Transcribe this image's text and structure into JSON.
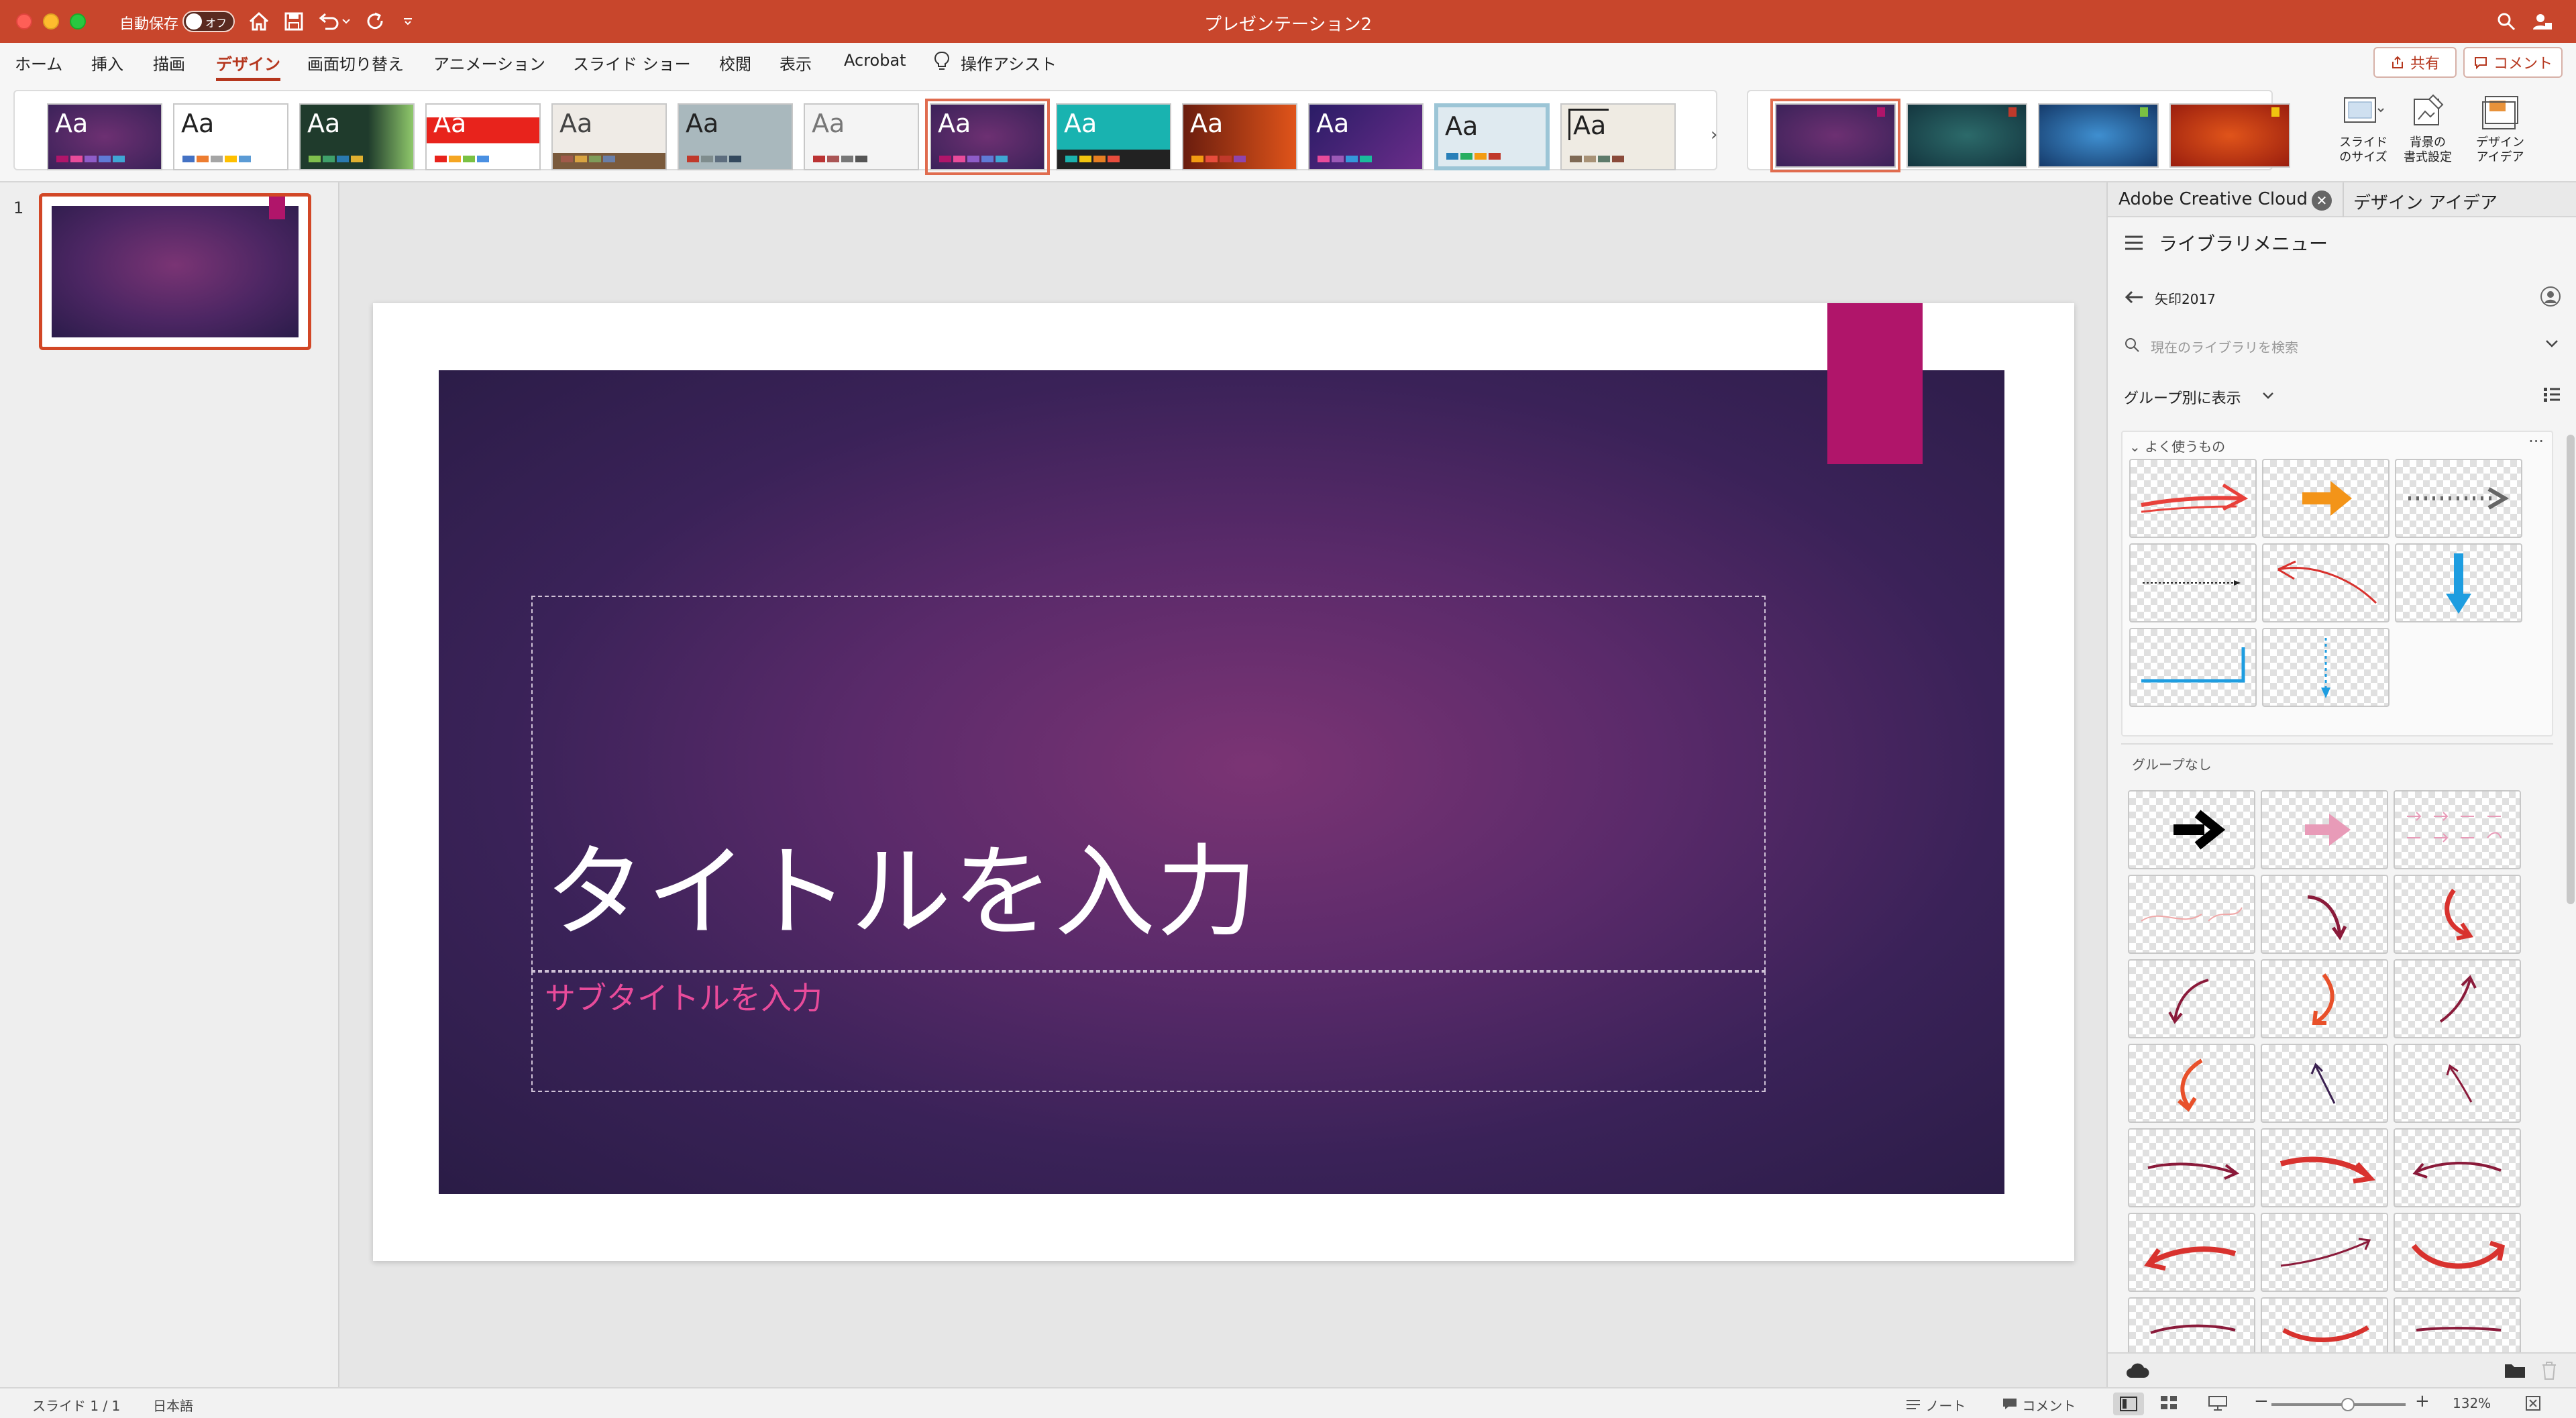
{
  "app": {
    "autosave_label": "自動保存",
    "autosave_state": "オフ",
    "document_title": "プレゼンテーション2"
  },
  "tabs": [
    {
      "label": "ホーム"
    },
    {
      "label": "挿入"
    },
    {
      "label": "描画"
    },
    {
      "label": "デザイン",
      "active": true
    },
    {
      "label": "画面切り替え"
    },
    {
      "label": "アニメーション"
    },
    {
      "label": "スライド ショー"
    },
    {
      "label": "校閲"
    },
    {
      "label": "表示"
    },
    {
      "label": "Acrobat"
    },
    {
      "label": "操作アシスト"
    }
  ],
  "header_buttons": {
    "share": "共有",
    "comment": "コメント"
  },
  "themes": {
    "aa": "Aa",
    "count": 13,
    "selected_index": 7
  },
  "ribbon_buttons": {
    "slide_size": "スライド\nのサイズ",
    "format_background": "背景の\n書式設定",
    "design_ideas": "デザイン\nアイデア"
  },
  "thumbnail": {
    "number": "1"
  },
  "slide": {
    "title_placeholder": "タイトルを入力",
    "subtitle_placeholder": "サブタイトルを入力"
  },
  "right_pane": {
    "tab_cc": "Adobe Creative Cloud",
    "tab_ideas": "デザイン アイデア",
    "library_menu": "ライブラリメニュー",
    "library_name": "矢印2017",
    "search_placeholder": "現在のライブラリを検索",
    "group_by": "グループ別に表示",
    "section_favorites": "よく使うもの",
    "section_nogroup": "グループなし"
  },
  "status": {
    "slide_count": "スライド 1 / 1",
    "language": "日本語",
    "notes": "ノート",
    "comments": "コメント",
    "zoom": "132%"
  },
  "colors": {
    "accent": "#c8462c",
    "slide_tag": "#b0156a",
    "subtitle": "#e84b9a"
  }
}
